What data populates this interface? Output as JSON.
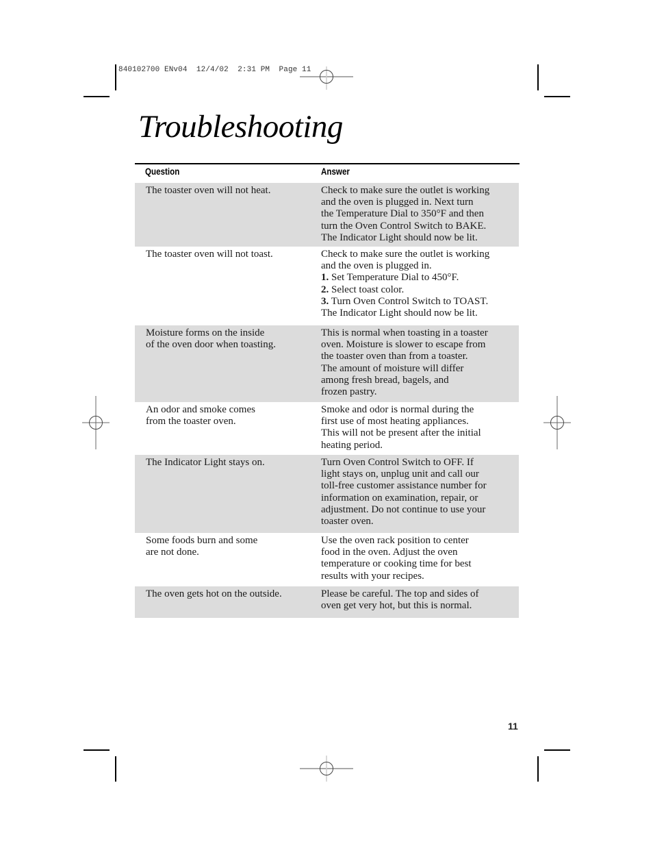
{
  "slug": "840102700 ENv04  12/4/02  2:31 PM  Page 11",
  "title": "Troubleshooting",
  "table": {
    "headers": {
      "question": "Question",
      "answer": "Answer"
    },
    "rows": [
      {
        "shaded": true,
        "question": [
          "The toaster oven will not heat."
        ],
        "answer": [
          {
            "text": "Check to make sure the outlet is working"
          },
          {
            "text": "and the oven is plugged in. Next turn"
          },
          {
            "text": "the Temperature Dial to 350°F and then"
          },
          {
            "text": "turn the Oven Control Switch to BAKE."
          },
          {
            "text": "The Indicator Light should now be lit."
          }
        ]
      },
      {
        "shaded": false,
        "question": [
          "The toaster oven will not toast."
        ],
        "answer": [
          {
            "text": "Check to make sure the outlet is working"
          },
          {
            "text": "and the oven is plugged in."
          },
          {
            "num": "1.",
            "text": " Set Temperature Dial to 450°F."
          },
          {
            "num": "2.",
            "text": " Select toast color."
          },
          {
            "num": "3.",
            "text": " Turn Oven Control Switch to TOAST."
          },
          {
            "text": "The Indicator Light should now be lit."
          }
        ]
      },
      {
        "shaded": true,
        "question": [
          "Moisture forms on the inside",
          "of the oven door when toasting."
        ],
        "answer": [
          {
            "text": "This is normal when toasting in a toaster"
          },
          {
            "text": "oven. Moisture is slower to escape from"
          },
          {
            "text": "the toaster oven than from a toaster."
          },
          {
            "text": "The amount of moisture will differ"
          },
          {
            "text": "among fresh bread, bagels, and"
          },
          {
            "text": "frozen pastry."
          }
        ]
      },
      {
        "shaded": false,
        "question": [
          "An odor and smoke comes",
          "from the toaster oven."
        ],
        "answer": [
          {
            "text": "Smoke and odor is normal during the"
          },
          {
            "text": "first use of most heating appliances."
          },
          {
            "text": "This will not be present after the initial"
          },
          {
            "text": "heating period."
          }
        ]
      },
      {
        "shaded": true,
        "question": [
          "The Indicator Light stays on."
        ],
        "answer": [
          {
            "text": "Turn Oven Control Switch to OFF. If"
          },
          {
            "text": "light stays on, unplug unit and call our"
          },
          {
            "text": "toll-free customer assistance number for"
          },
          {
            "text": "information on examination, repair, or"
          },
          {
            "text": "adjustment. Do not continue to use your"
          },
          {
            "text": "toaster oven."
          }
        ]
      },
      {
        "shaded": false,
        "question": [
          "Some foods burn and some",
          "are not done."
        ],
        "answer": [
          {
            "text": "Use the oven rack position to center"
          },
          {
            "text": "food in the oven. Adjust the oven"
          },
          {
            "text": "temperature or cooking time for best"
          },
          {
            "text": "results with your recipes."
          }
        ]
      },
      {
        "shaded": true,
        "question": [
          "The oven gets hot on the outside."
        ],
        "answer": [
          {
            "text": "Please be careful. The top and sides of"
          },
          {
            "text": "oven get very hot, but this is normal."
          }
        ]
      }
    ]
  },
  "page_number": "11",
  "colors": {
    "row_shade": "#dcdcdc",
    "text": "#1a1a1a",
    "rule": "#000000"
  }
}
